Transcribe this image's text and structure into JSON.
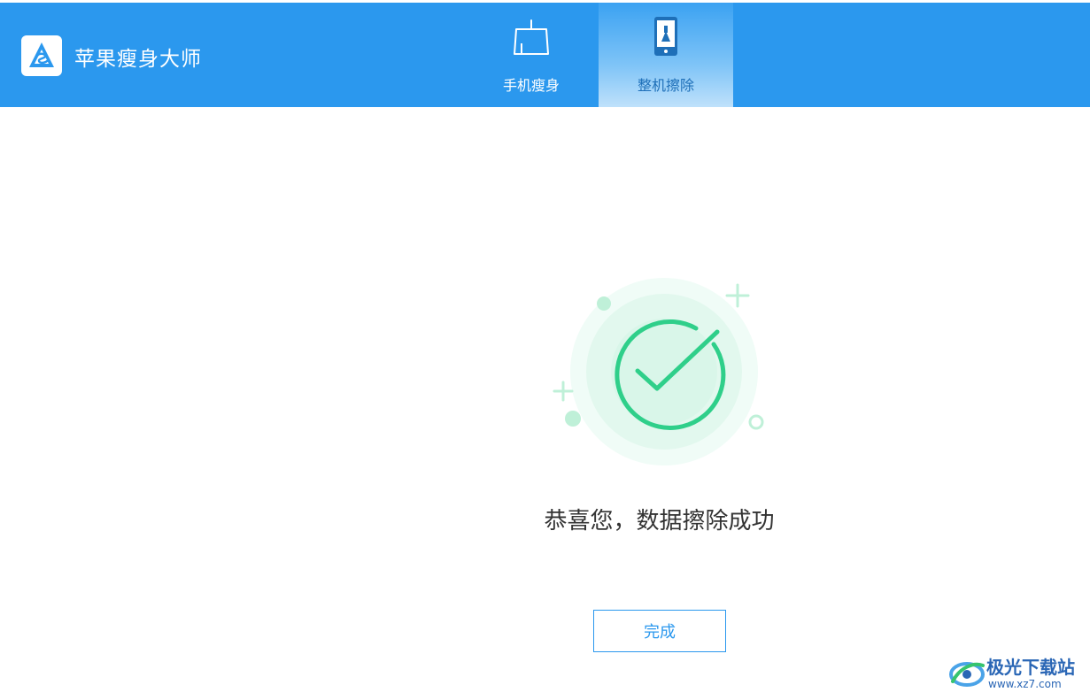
{
  "app": {
    "title": "苹果瘦身大师"
  },
  "tabs": [
    {
      "label": "手机瘦身",
      "icon": "broom-icon",
      "active": false
    },
    {
      "label": "整机擦除",
      "icon": "phone-clean-icon",
      "active": true
    }
  ],
  "result": {
    "message": "恭喜您，数据擦除成功",
    "icon": "check-circle-icon",
    "accent": "#2fcf8a"
  },
  "actions": {
    "done_label": "完成"
  },
  "watermark": {
    "title": "极光下载站",
    "url": "www.xz7.com"
  },
  "colors": {
    "header": "#2b98ee",
    "success": "#2fcf8a"
  }
}
